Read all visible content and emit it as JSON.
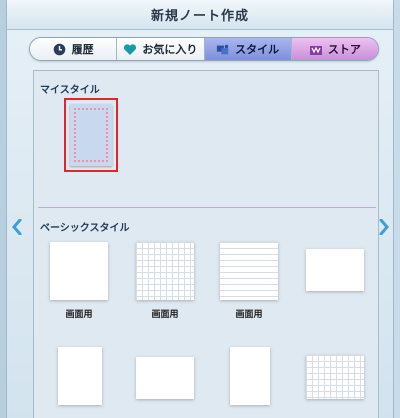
{
  "window": {
    "title": "新規ノート作成"
  },
  "tabs": [
    {
      "label": "履歴",
      "icon": "clock-icon"
    },
    {
      "label": "お気に入り",
      "icon": "heart-icon"
    },
    {
      "label": "スタイル",
      "icon": "style-icon",
      "active": true
    },
    {
      "label": "ストア",
      "icon": "store-icon"
    }
  ],
  "my_styles": {
    "heading": "マイスタイル"
  },
  "basic_styles": {
    "heading": "ベーシックスタイル",
    "items": [
      {
        "label": "画面用"
      },
      {
        "label": "画面用"
      },
      {
        "label": "画面用"
      }
    ]
  },
  "colors": {
    "active_tab": "#8c9ee3",
    "store_tab": "#d9a8e4",
    "selection": "#e0262b",
    "nav_arrow": "#3aa0d6"
  }
}
